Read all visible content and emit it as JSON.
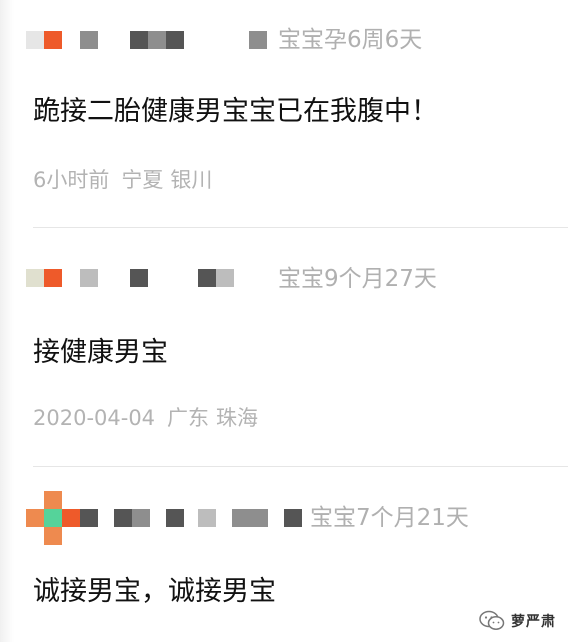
{
  "posts": [
    {
      "baby_age": "宝宝孕6周6天",
      "content": "跪接二胎健康男宝宝已在我腹中！",
      "time": "6小时前",
      "province": "宁夏",
      "city": "银川"
    },
    {
      "baby_age": "宝宝9个月27天",
      "content": "接健康男宝",
      "time": "2020-04-04",
      "province": "广东",
      "city": "珠海"
    },
    {
      "baby_age": "宝宝7个月21天",
      "content": "诚接男宝，诚接男宝"
    }
  ],
  "watermark": {
    "label": "萝严肃",
    "icon": "wechat-icon"
  },
  "colors": {
    "avatar_orange": "#ee5a2a",
    "avatar_green": "#55d39a",
    "mosaic_dark": "#555555",
    "mosaic_mid": "#8e8e8e",
    "mosaic_light": "#bdbdbd",
    "meta_text": "#b3b3b3"
  }
}
